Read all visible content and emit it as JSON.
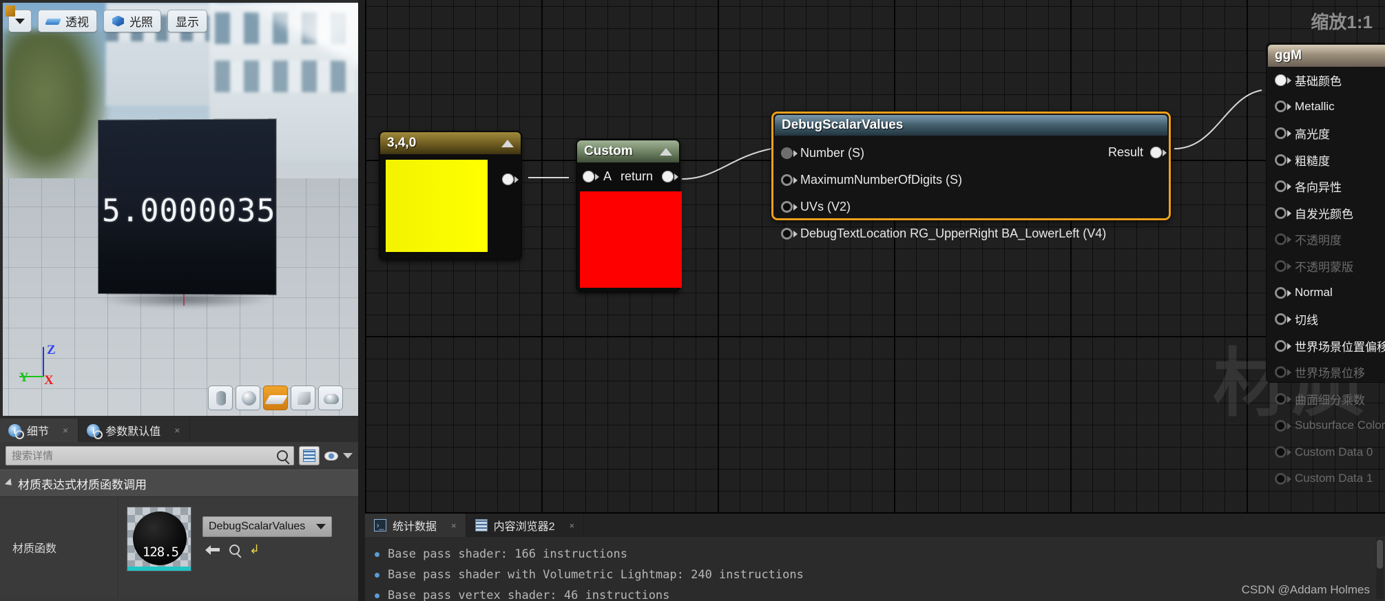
{
  "viewport": {
    "toolbar": [
      {
        "id": "view-options",
        "label": "",
        "icon": "chevron-down-icon"
      },
      {
        "id": "perspective",
        "label": "透视",
        "icon": "perspective-icon"
      },
      {
        "id": "lighting",
        "label": "光照",
        "icon": "cube-icon"
      },
      {
        "id": "show",
        "label": "显示",
        "icon": "none"
      }
    ],
    "debug_number": "5.0000035",
    "axis_labels": {
      "x": "X",
      "y": "Y",
      "z": "Z"
    },
    "axis_colors": {
      "x": "#e81c1c",
      "y": "#17c217",
      "z": "#2f44ee"
    },
    "mesh_shapes": [
      {
        "id": "cylinder",
        "name": "cylinder-preview",
        "active": false
      },
      {
        "id": "sphere",
        "name": "sphere-preview",
        "active": false
      },
      {
        "id": "plane",
        "name": "plane-preview",
        "active": true
      },
      {
        "id": "cube",
        "name": "cube-preview",
        "active": false
      },
      {
        "id": "teapot",
        "name": "teapot-preview",
        "active": false
      }
    ]
  },
  "details": {
    "tabs": [
      {
        "label": "细节",
        "active": true,
        "close": "×"
      },
      {
        "label": "参数默认值",
        "active": false,
        "close": "×"
      }
    ],
    "search_placeholder": "搜索详情",
    "search_value": "",
    "category": "材质表达式材质函数调用",
    "row_label": "材质函数",
    "material_function": "DebugScalarValues",
    "thumbnail_text": "128.5"
  },
  "graph": {
    "zoom_label": "缩放1:1",
    "watermark": "材质",
    "nodes": {
      "constant": {
        "title": "3,4,0",
        "color": "#ffff00",
        "header_color": "#6e5b20"
      },
      "custom": {
        "title": "Custom",
        "input_label": "A",
        "output_label": "return",
        "color": "#ff0000",
        "header_color": "#6c7f61"
      },
      "debug": {
        "title": "DebugScalarValues",
        "selected": true,
        "selection_color": "#f0a11a",
        "inputs": [
          {
            "label": "Number (S)",
            "connected": true
          },
          {
            "label": "MaximumNumberOfDigits (S)",
            "connected": false
          },
          {
            "label": "UVs (V2)",
            "connected": false
          },
          {
            "label": "DebugTextLocation RG_UpperRight BA_LowerLeft (V4)",
            "connected": false
          }
        ],
        "output": {
          "label": "Result",
          "connected": true
        }
      },
      "material_output": {
        "title": "ggM",
        "pins": [
          {
            "label": "基础颜色",
            "connected": true,
            "enabled": true
          },
          {
            "label": "Metallic",
            "connected": false,
            "enabled": true
          },
          {
            "label": "高光度",
            "connected": false,
            "enabled": true
          },
          {
            "label": "粗糙度",
            "connected": false,
            "enabled": true
          },
          {
            "label": "各向异性",
            "connected": false,
            "enabled": true
          },
          {
            "label": "自发光颜色",
            "connected": false,
            "enabled": true
          },
          {
            "label": "不透明度",
            "connected": false,
            "enabled": false
          },
          {
            "label": "不透明蒙版",
            "connected": false,
            "enabled": false
          },
          {
            "label": "Normal",
            "connected": false,
            "enabled": true
          },
          {
            "label": "切线",
            "connected": false,
            "enabled": true
          },
          {
            "label": "世界场景位置偏移",
            "connected": false,
            "enabled": true
          },
          {
            "label": "世界场景位移",
            "connected": false,
            "enabled": false
          },
          {
            "label": "曲面细分乘数",
            "connected": false,
            "enabled": false
          },
          {
            "label": "Subsurface Color",
            "connected": false,
            "enabled": false
          },
          {
            "label": "Custom Data 0",
            "connected": false,
            "enabled": false
          },
          {
            "label": "Custom Data 1",
            "connected": false,
            "enabled": false
          }
        ]
      }
    }
  },
  "stats": {
    "tabs": [
      {
        "label": "统计数据",
        "active": true,
        "close": "×",
        "icon": "stats-icon"
      },
      {
        "label": "内容浏览器2",
        "active": false,
        "close": "×",
        "icon": "content-browser-icon"
      }
    ],
    "lines": [
      "Base pass shader: 166 instructions",
      "Base pass shader with Volumetric Lightmap: 240 instructions",
      "Base pass vertex shader: 46 instructions"
    ],
    "watermark": "CSDN @Addam Holmes"
  }
}
